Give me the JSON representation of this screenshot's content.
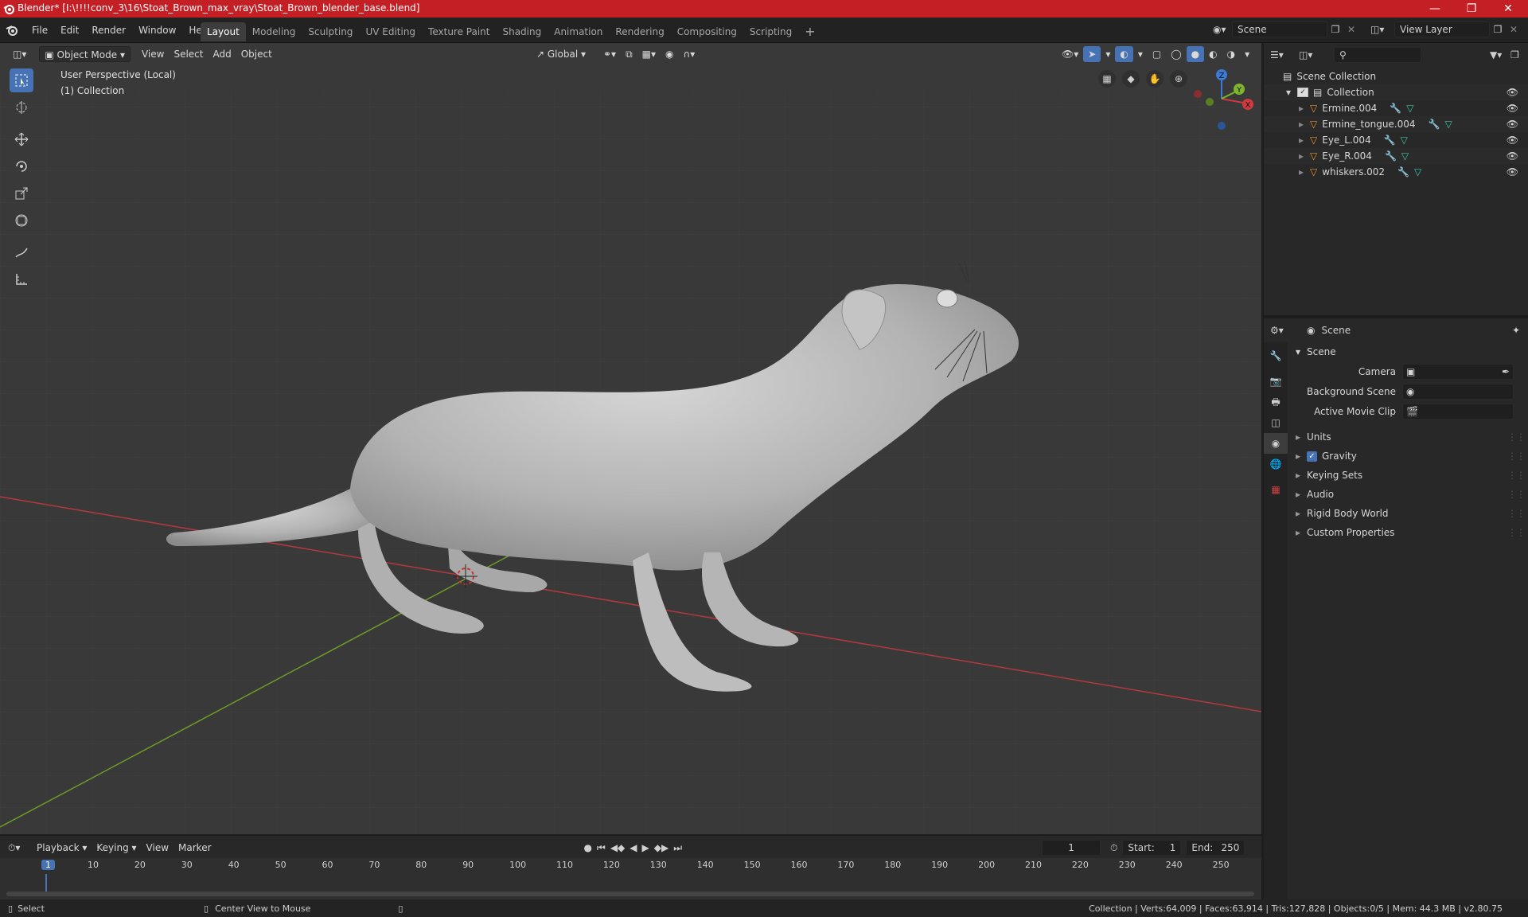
{
  "window": {
    "title": "Blender* [I:\\!!!!conv_3\\16\\Stoat_Brown_max_vray\\Stoat_Brown_blender_base.blend]",
    "controls": [
      "minimize",
      "restore",
      "close"
    ]
  },
  "menu": [
    "File",
    "Edit",
    "Render",
    "Window",
    "Help"
  ],
  "workspaces": [
    "Layout",
    "Modeling",
    "Sculpting",
    "UV Editing",
    "Texture Paint",
    "Shading",
    "Animation",
    "Rendering",
    "Compositing",
    "Scripting"
  ],
  "active_workspace": "Layout",
  "scene_field": "Scene",
  "view_layer_field": "View Layer",
  "viewport": {
    "mode": "Object Mode",
    "menus": [
      "View",
      "Select",
      "Add",
      "Object"
    ],
    "orientation": "Global",
    "overlay_text": {
      "line1": "User Perspective (Local)",
      "line2": "(1) Collection"
    },
    "gizmo": {
      "z": "Z",
      "y": "Y",
      "x": "X"
    }
  },
  "outliner": {
    "root": "Scene Collection",
    "collection": "Collection",
    "items": [
      "Ermine.004",
      "Ermine_tongue.004",
      "Eye_L.004",
      "Eye_R.004",
      "whiskers.002"
    ]
  },
  "properties": {
    "header": "Scene",
    "section": "Scene",
    "camera_label": "Camera",
    "background_scene_label": "Background Scene",
    "active_clip_label": "Active Movie Clip",
    "subsections": [
      "Units",
      "Gravity",
      "Keying Sets",
      "Audio",
      "Rigid Body World",
      "Custom Properties"
    ],
    "gravity_checked": true
  },
  "timeline": {
    "menus": [
      "Playback",
      "Keying",
      "View",
      "Marker"
    ],
    "current_frame": "1",
    "start_label": "Start:",
    "start": "1",
    "end_label": "End:",
    "end": "250",
    "ruler": [
      "1",
      "10",
      "20",
      "30",
      "40",
      "50",
      "60",
      "70",
      "80",
      "90",
      "100",
      "110",
      "120",
      "130",
      "140",
      "150",
      "160",
      "170",
      "180",
      "190",
      "200",
      "210",
      "220",
      "230",
      "240",
      "250"
    ]
  },
  "status": {
    "select": "Select",
    "center": "Center View to Mouse",
    "stats": "Collection | Verts:64,009 | Faces:63,914 | Tris:127,828 | Objects:0/5 | Mem: 44.3 MB | v2.80.75"
  },
  "colors": {
    "titlebar": "#c41f25",
    "accent": "#4772b3",
    "object_icon": "#e8912e",
    "x_axis": "#d0393e",
    "y_axis": "#7fb52b",
    "z_axis": "#3b7ad6"
  }
}
